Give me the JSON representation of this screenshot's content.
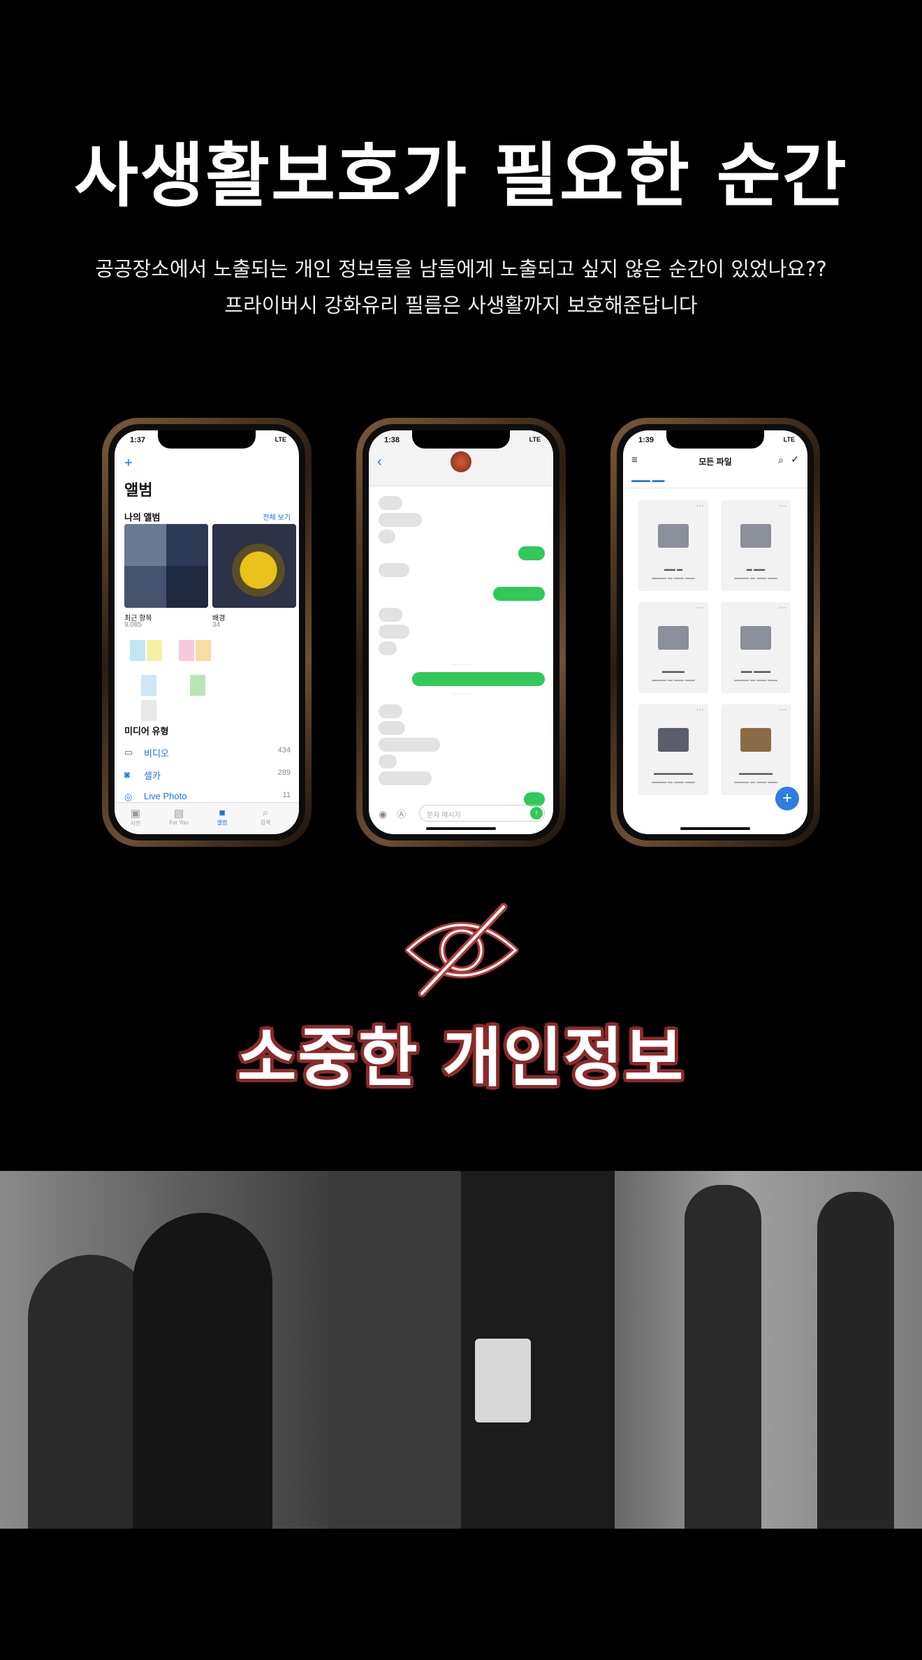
{
  "header": {
    "title": "사생활보호가 필요한 순간",
    "subtitle_line1": "공공장소에서 노출되는 개인 정보들을 남들에게 노출되고 싶지 않은 순간이 있었나요??",
    "subtitle_line2": "프라이버시 강화유리 필름은 사생활까지 보호해준답니다"
  },
  "phones": {
    "photos": {
      "time": "1:37",
      "signal": "LTE",
      "add_icon": "plus-icon",
      "title": "앨범",
      "section": "나의 앨범",
      "see_all": "전체 보기",
      "albums": [
        {
          "label": "최근 항목",
          "count": "9,085"
        },
        {
          "label": "배경",
          "count": "34"
        }
      ],
      "media_section": "미디어 유형",
      "media": [
        {
          "label": "비디오",
          "count": "434",
          "icon": "video-icon"
        },
        {
          "label": "셀카",
          "count": "289",
          "icon": "selfie-icon"
        },
        {
          "label": "Live Photo",
          "count": "11",
          "icon": "live-photo-icon"
        }
      ],
      "tabs": [
        "사진",
        "For You",
        "앨범",
        "검색"
      ]
    },
    "messages": {
      "time": "1:38",
      "signal": "LTE",
      "input_placeholder": "문자 메시지"
    },
    "files": {
      "time": "1:39",
      "signal": "LTE",
      "title": "모든 파일"
    }
  },
  "slogan": "소중한 개인정보",
  "colors": {
    "background": "#000000",
    "slogan_stroke": "#8b2a2a",
    "eye_icon": "#b23a3a",
    "ios_blue": "#1a73e8",
    "bubble_green": "#32c85a"
  }
}
